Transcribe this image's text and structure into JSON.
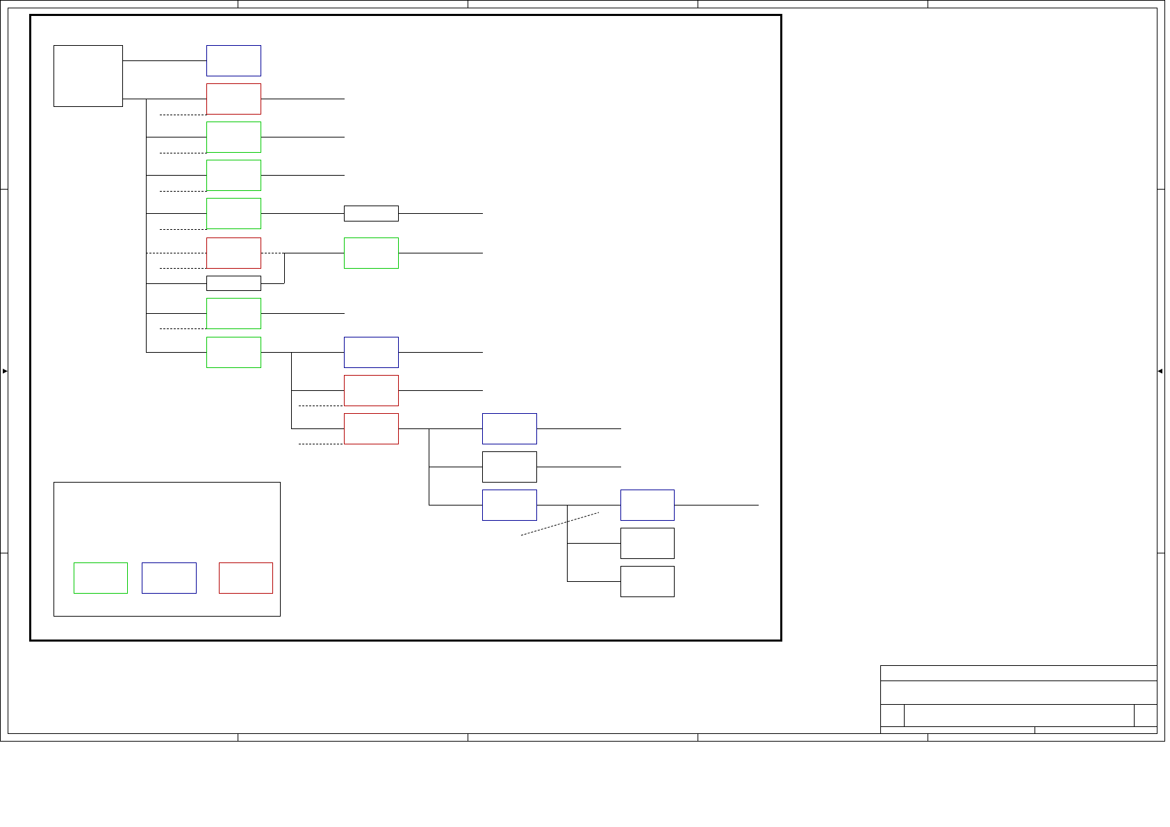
{
  "document": {
    "type": "schematic-sheet",
    "text_content": []
  },
  "colors": {
    "background": "#ffffff",
    "line": "#000000",
    "green": "#00c800",
    "red": "#b40000",
    "blue": "#000096"
  },
  "legend": {
    "swatches": [
      {
        "color": "green"
      },
      {
        "color": "blue"
      },
      {
        "color": "red"
      }
    ]
  },
  "title_block": {
    "text_fields": []
  }
}
